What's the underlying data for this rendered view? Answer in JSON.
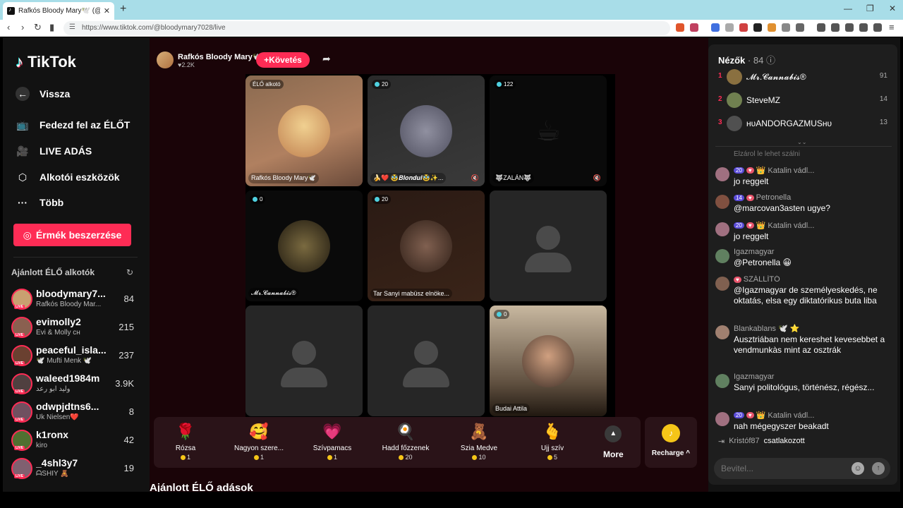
{
  "browser": {
    "tab_title": "Rafkós Bloody Mary🕊️ (@blo",
    "url": "https://www.tiktok.com/@bloodymary7028/live"
  },
  "nav": {
    "logo": "TikTok",
    "back": "Vissza",
    "explore": "Fedezd fel az ÉLŐT",
    "live": "LIVE ADÁS",
    "tools": "Alkotói eszközök",
    "more": "Több",
    "coins_button": "Érmék beszerzése",
    "recommended_title": "Ajánlott ÉLŐ alkotók",
    "live_tag": "LIVE",
    "creators": [
      {
        "name": "bloodymary7...",
        "sub": "Rafkós Bloody Mar...",
        "count": "84",
        "color": "#c9a070"
      },
      {
        "name": "evimolly2",
        "sub": "Évi & Molly ᴄʜ",
        "count": "215",
        "color": "#8a6050"
      },
      {
        "name": "peaceful_isla...",
        "sub": "🕊️ Mufti Menk 🕊️",
        "count": "237",
        "color": "#6a4030"
      },
      {
        "name": "waleed1984m",
        "sub": "وليد ابو رعد",
        "count": "3.9K",
        "color": "#504040"
      },
      {
        "name": "odwpjdtns6...",
        "sub": "Uk Nielsen❤️",
        "count": "8",
        "color": "#705060"
      },
      {
        "name": "k1ronx",
        "sub": "kiro",
        "count": "42",
        "color": "#507030"
      },
      {
        "name": "_4shl3y7",
        "sub": "ᗩSHIY 🧸",
        "count": "19",
        "color": "#806070"
      }
    ]
  },
  "stream": {
    "host_name": "Rafkós Bloody Mary🕊️",
    "host_likes": "♥2.2K",
    "follow": "+Követés",
    "tiles": [
      {
        "badge": "ÉLŐ alkotó",
        "label": "Rafkós Bloody Mary🕊️"
      },
      {
        "badge": "20",
        "label": "🍌❤️ 🥸𝑩𝒍𝒐𝒏𝒅𝒖𝒍🥸✨..."
      },
      {
        "badge": "122",
        "label": "🐺ZALÁN🐺"
      },
      {
        "badge": "0",
        "label": "𝓜𝓻.𝓒𝓪𝓷𝓷𝓪𝓫𝓲𝓼®"
      },
      {
        "badge": "20",
        "label": "Tar Sanyi mabüsz elnöke..."
      },
      {
        "badge": "",
        "label": ""
      },
      {
        "badge": "",
        "label": ""
      },
      {
        "badge": "",
        "label": ""
      },
      {
        "badge": "0",
        "label": "Budai Attila"
      }
    ],
    "gifts": [
      {
        "icon": "🌹",
        "name": "Rózsa",
        "price": "1"
      },
      {
        "icon": "🥰",
        "name": "Nagyon szere...",
        "price": "1"
      },
      {
        "icon": "💗",
        "name": "Szívpamacs",
        "price": "1"
      },
      {
        "icon": "🍳",
        "name": "Hadd főzzenek",
        "price": "20"
      },
      {
        "icon": "🧸",
        "name": "Szia Medve",
        "price": "10"
      },
      {
        "icon": "🫰",
        "name": "Ujj szív",
        "price": "5"
      }
    ],
    "more": "More",
    "recharge": "Recharge ^",
    "recommended_live": "Ajánlott ÉLŐ adások"
  },
  "chat": {
    "viewers_title": "Nézők",
    "viewers_count": "· 84",
    "viewers": [
      {
        "rank": "1",
        "name": "𝓜𝓻.𝓒𝓪𝓷𝓷𝓪𝓫𝓲𝓼®",
        "score": "91",
        "color": "#8a7040"
      },
      {
        "rank": "2",
        "name": "SteveMZ",
        "score": "14",
        "color": "#708050"
      },
      {
        "rank": "3",
        "name": "ʜᴜANDORGAZMUSʜᴜ",
        "score": "13",
        "color": "#505050"
      }
    ],
    "faded": "Elzárol le lehet szálni",
    "messages": [
      {
        "user": "Katalin vádl...",
        "lvl": "20",
        "text": "jo reggelt",
        "color": "#a07080"
      },
      {
        "user": "Petronella",
        "lvl": "14",
        "text": "@marcovan3asten ugye?",
        "color": "#805040"
      },
      {
        "user": "Katalin vádl...",
        "lvl": "20",
        "text": "jo reggelt",
        "color": "#a07080"
      },
      {
        "user": "Igazmagyar",
        "lvl": "",
        "text": "@Petronella 😀",
        "color": "#608060"
      },
      {
        "user": "SZÁLLÍTÓ",
        "lvl": "",
        "text": "@Igazmagyar de személyeskedés, ne oktatás, elsa egy diktatórikus buta liba",
        "color": "#806050"
      },
      {
        "user": "Blankablans 🕊️ ⭐",
        "lvl": "",
        "text": "Ausztriában nem kereshet kevesebbet a vendmunkàs mint az osztrák",
        "color": "#a08070"
      },
      {
        "user": "Igazmagyar",
        "lvl": "",
        "text": "Sanyi politológus, történész, régész...",
        "color": "#608060"
      },
      {
        "user": "Katalin vádl...",
        "lvl": "20",
        "text": "nah mégegyszer beakadt",
        "color": "#a07080"
      }
    ],
    "joined_user": "Kristóf87",
    "joined_text": "csatlakozott",
    "input_placeholder": "Bevitel..."
  }
}
